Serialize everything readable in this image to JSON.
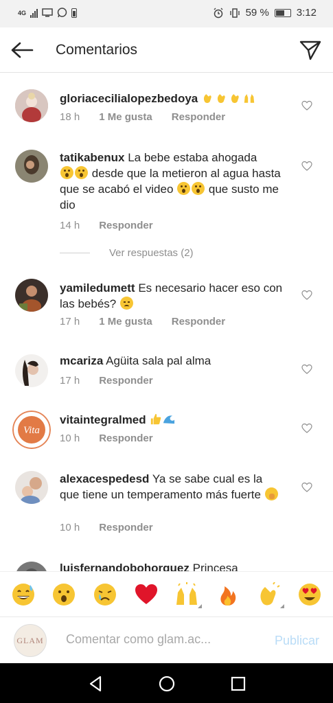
{
  "status_bar": {
    "left_label": "4G",
    "battery_percent": "59 %",
    "time": "3:12"
  },
  "header": {
    "title": "Comentarios"
  },
  "comments": [
    {
      "username": "gloriacecilialopezbedoya",
      "text": "",
      "emojis": [
        "clapping-hands",
        "clapping-hands",
        "clapping-hands",
        "raising-hands"
      ],
      "time": "18 h",
      "likes": "1 Me gusta",
      "reply": "Responder"
    },
    {
      "username": "tatikabenux",
      "text_1": "La bebe estaba ahogada",
      "text_2": "desde que la metieron al agua hasta que se acabó el video",
      "text_3": "que susto me dio",
      "time": "14 h",
      "reply": "Responder"
    },
    {
      "username": "yamiledumett",
      "text": "Es necesario hacer eso con las bebés?",
      "time": "17 h",
      "likes": "1 Me gusta",
      "reply": "Responder"
    },
    {
      "username": "mcariza",
      "text": "Agüita sala pal alma",
      "time": "17 h",
      "reply": "Responder"
    },
    {
      "username": "vitaintegralmed",
      "text": "",
      "time": "10 h",
      "reply": "Responder"
    },
    {
      "username": "alexacespedesd",
      "text": "Ya se sabe cual es la que tiene un temperamento más fuerte",
      "time": "10 h",
      "reply": "Responder"
    },
    {
      "username": "luisfernandobohorquez",
      "text": "Princesa"
    }
  ],
  "view_replies": "Ver respuestas (2)",
  "quick_emojis": [
    "grinning-sweat",
    "astonished",
    "crying",
    "red-heart",
    "raising-hands",
    "fire",
    "clapping-hands",
    "heart-eyes"
  ],
  "input": {
    "placeholder": "Comentar como glam.ac...",
    "publish_label": "Publicar"
  },
  "my_avatar_text": "GLAM",
  "vita_logo_text": "Vita",
  "colors": {
    "text": "#262626",
    "meta": "#8e8e8e",
    "publish_disabled": "#b9dcf7",
    "emoji_yellow": "#f7c533",
    "heart_red": "#e0152a",
    "nav_bg": "#000000"
  }
}
